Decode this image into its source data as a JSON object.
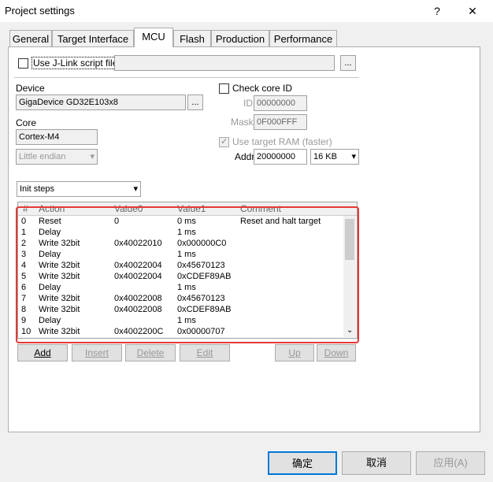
{
  "window": {
    "title": "Project settings",
    "help": "?",
    "close": "✕"
  },
  "tabs": [
    "General",
    "Target Interface",
    "MCU",
    "Flash",
    "Production",
    "Performance"
  ],
  "jlink": {
    "label": "Use J-Link script file",
    "path": "",
    "browse": "..."
  },
  "device": {
    "label": "Device",
    "value": "GigaDevice GD32E103x8",
    "browse": "..."
  },
  "core": {
    "label": "Core",
    "value": "Cortex-M4",
    "endian": "Little endian"
  },
  "check_core": {
    "label": "Check core ID",
    "id_label": "ID",
    "id_value": "00000000",
    "mask_label": "Mask",
    "mask_value": "0F000FFF"
  },
  "ram": {
    "label": "Use target RAM (faster)",
    "addr_label": "Addr",
    "addr_value": "20000000",
    "size": "16 KB"
  },
  "steps": {
    "dropdown": "Init steps",
    "headers": [
      "#",
      "Action",
      "Value0",
      "Value1",
      "Comment"
    ],
    "rows": [
      [
        "0",
        "Reset",
        "0",
        "0 ms",
        "Reset and halt target"
      ],
      [
        "1",
        "Delay",
        "",
        "1 ms",
        ""
      ],
      [
        "2",
        "Write 32bit",
        "0x40022010",
        "0x000000C0",
        ""
      ],
      [
        "3",
        "Delay",
        "",
        "1 ms",
        ""
      ],
      [
        "4",
        "Write 32bit",
        "0x40022004",
        "0x45670123",
        ""
      ],
      [
        "5",
        "Write 32bit",
        "0x40022004",
        "0xCDEF89AB",
        ""
      ],
      [
        "6",
        "Delay",
        "",
        "1 ms",
        ""
      ],
      [
        "7",
        "Write 32bit",
        "0x40022008",
        "0x45670123",
        ""
      ],
      [
        "8",
        "Write 32bit",
        "0x40022008",
        "0xCDEF89AB",
        ""
      ],
      [
        "9",
        "Delay",
        "",
        "1 ms",
        ""
      ],
      [
        "10",
        "Write 32bit",
        "0x4002200C",
        "0x00000707",
        ""
      ]
    ]
  },
  "step_buttons": {
    "add": "Add",
    "insert": "Insert",
    "delete": "Delete",
    "edit": "Edit",
    "up": "Up",
    "down": "Down"
  },
  "footer": {
    "ok": "确定",
    "cancel": "取消",
    "apply": "应用(A)"
  },
  "colors": {
    "highlight": "#e53935"
  }
}
